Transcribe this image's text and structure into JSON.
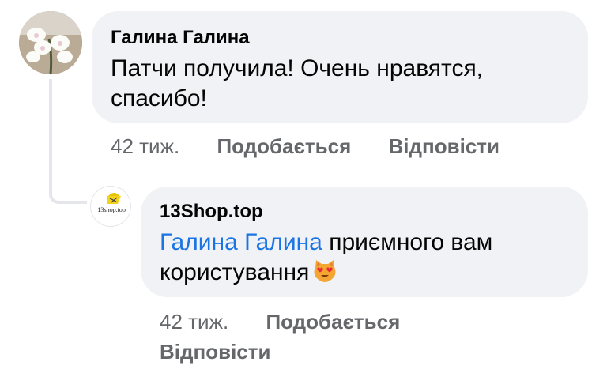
{
  "comments": [
    {
      "author": "Галина Галина",
      "text": "Патчи получила! Очень нравятся, спасибо!",
      "time": "42 тиж.",
      "like_label": "Подобається",
      "reply_label": "Відповісти",
      "avatar_icon": "orchid-photo-avatar"
    },
    {
      "author": "13Shop.top",
      "mention": "Галина Галина",
      "text": "приємного вам користування",
      "emoji_icon": "heart-eyes-cat-emoji",
      "time": "42 тиж.",
      "like_label": "Подобається",
      "reply_label": "Відповісти",
      "avatar_icon": "13shop-logo-avatar",
      "logo_text": "13shop.top"
    }
  ],
  "colors": {
    "bubble": "#f0f2f5",
    "mention": "#1b74e4",
    "secondary_text": "#65676b",
    "primary_text": "#050505"
  }
}
